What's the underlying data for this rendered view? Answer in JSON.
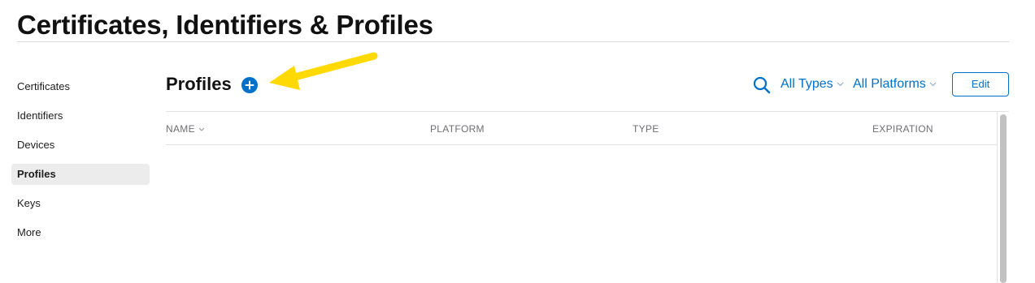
{
  "header": {
    "title": "Certificates, Identifiers & Profiles"
  },
  "sidebar": {
    "items": [
      {
        "label": "Certificates"
      },
      {
        "label": "Identifiers"
      },
      {
        "label": "Devices"
      },
      {
        "label": "Profiles",
        "active": true
      },
      {
        "label": "Keys"
      },
      {
        "label": "More"
      }
    ]
  },
  "main": {
    "section_title": "Profiles",
    "filters": {
      "types_label": "All Types",
      "platforms_label": "All Platforms"
    },
    "edit_label": "Edit",
    "table": {
      "columns": [
        "NAME",
        "PLATFORM",
        "TYPE",
        "EXPIRATION"
      ],
      "rows": []
    }
  },
  "icons": {
    "add": "plus-circle-icon",
    "search": "search-icon",
    "dropdown": "chevron-down-icon",
    "annotation": "arrow-annotation"
  },
  "colors": {
    "accent": "#0070c9",
    "annotation": "#ffd900",
    "active_background": "#ececec"
  }
}
